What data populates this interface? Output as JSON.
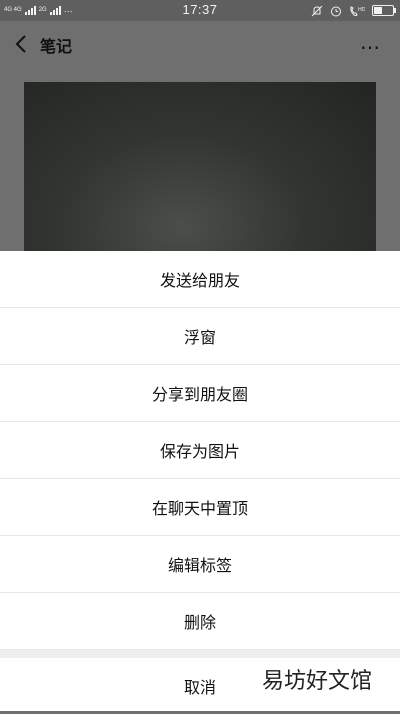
{
  "status": {
    "network_top": "4G 4G",
    "network_bottom": "2G",
    "dots": "···",
    "time": "17:37"
  },
  "header": {
    "title": "笔记",
    "more": "…"
  },
  "menu": {
    "items": [
      {
        "label": "发送给朋友"
      },
      {
        "label": "浮窗"
      },
      {
        "label": "分享到朋友圈"
      },
      {
        "label": "保存为图片"
      },
      {
        "label": "在聊天中置顶"
      },
      {
        "label": "编辑标签"
      },
      {
        "label": "删除"
      }
    ],
    "cancel": "取消"
  },
  "watermark": "易坊好文馆"
}
